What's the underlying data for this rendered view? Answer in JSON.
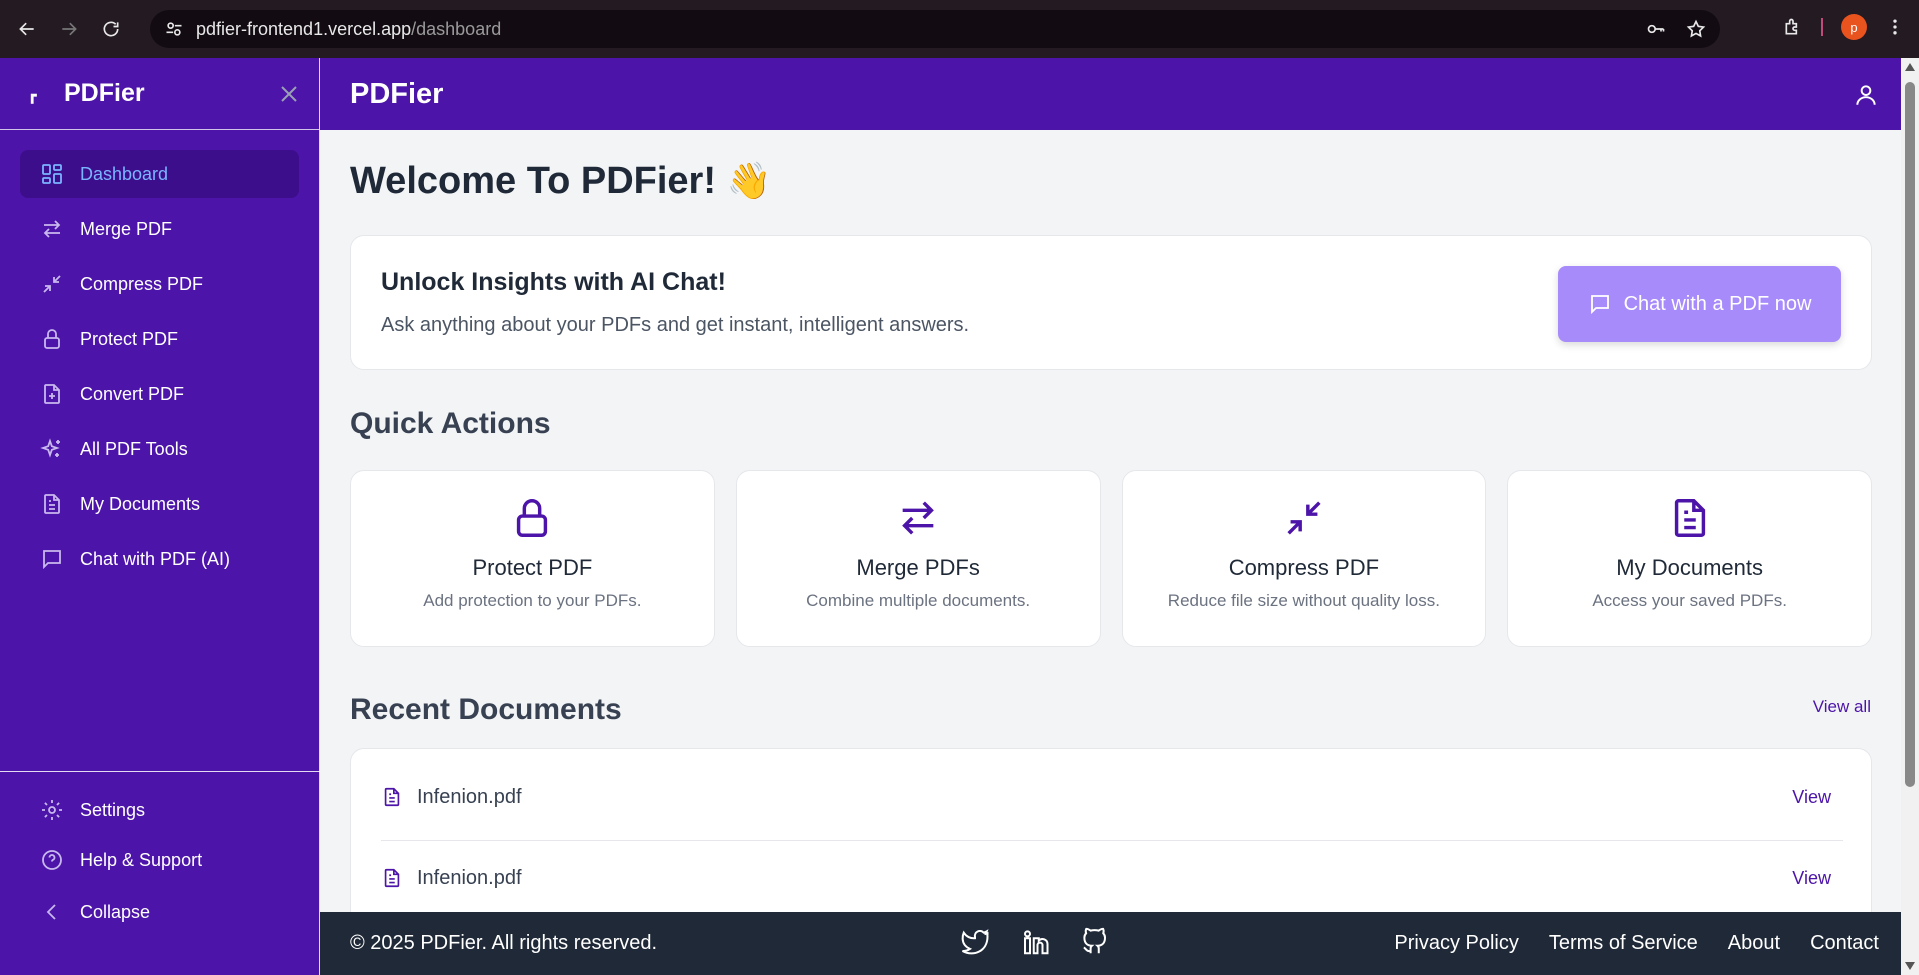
{
  "browser": {
    "url_host": "pdfier-frontend1.vercel.app",
    "url_path": "/dashboard",
    "profile_initial": "p"
  },
  "sidebar": {
    "title": "PDFier",
    "items": [
      {
        "label": "Dashboard",
        "icon": "dashboard-icon",
        "active": true
      },
      {
        "label": "Merge PDF",
        "icon": "arrows-swap-icon"
      },
      {
        "label": "Compress PDF",
        "icon": "compress-icon"
      },
      {
        "label": "Protect PDF",
        "icon": "lock-icon"
      },
      {
        "label": "Convert PDF",
        "icon": "file-plus-icon"
      },
      {
        "label": "All PDF Tools",
        "icon": "sparkles-icon"
      },
      {
        "label": "My Documents",
        "icon": "document-icon"
      },
      {
        "label": "Chat with PDF (AI)",
        "icon": "chat-icon"
      }
    ],
    "bottom": {
      "settings": "Settings",
      "help": "Help & Support",
      "collapse": "Collapse"
    }
  },
  "header": {
    "title": "PDFier"
  },
  "main": {
    "welcome": "Welcome To PDFier!",
    "welcome_emoji": "👋",
    "ai_card": {
      "title": "Unlock Insights with AI Chat!",
      "subtitle": "Ask anything about your PDFs and get instant, intelligent answers.",
      "button": "Chat with a PDF now"
    },
    "quick_actions": {
      "title": "Quick Actions",
      "cards": [
        {
          "title": "Protect PDF",
          "desc": "Add protection to your PDFs.",
          "icon": "lock-icon"
        },
        {
          "title": "Merge PDFs",
          "desc": "Combine multiple documents.",
          "icon": "arrows-swap-icon"
        },
        {
          "title": "Compress PDF",
          "desc": "Reduce file size without quality loss.",
          "icon": "compress-icon"
        },
        {
          "title": "My Documents",
          "desc": "Access your saved PDFs.",
          "icon": "document-icon"
        }
      ]
    },
    "recent": {
      "title": "Recent Documents",
      "view_all": "View all",
      "docs": [
        {
          "name": "Infenion.pdf",
          "action": "View"
        },
        {
          "name": "Infenion.pdf",
          "action": "View"
        }
      ]
    }
  },
  "footer": {
    "copyright": "© 2025 PDFier. All rights reserved.",
    "links": [
      "Privacy Policy",
      "Terms of Service",
      "About",
      "Contact"
    ],
    "social": [
      "twitter-icon",
      "linkedin-icon",
      "github-icon"
    ]
  },
  "colors": {
    "brand": "#4c14a8",
    "active_text": "#7ab4ff",
    "ai_button": "#a78bfa",
    "footer": "#1f2937"
  }
}
